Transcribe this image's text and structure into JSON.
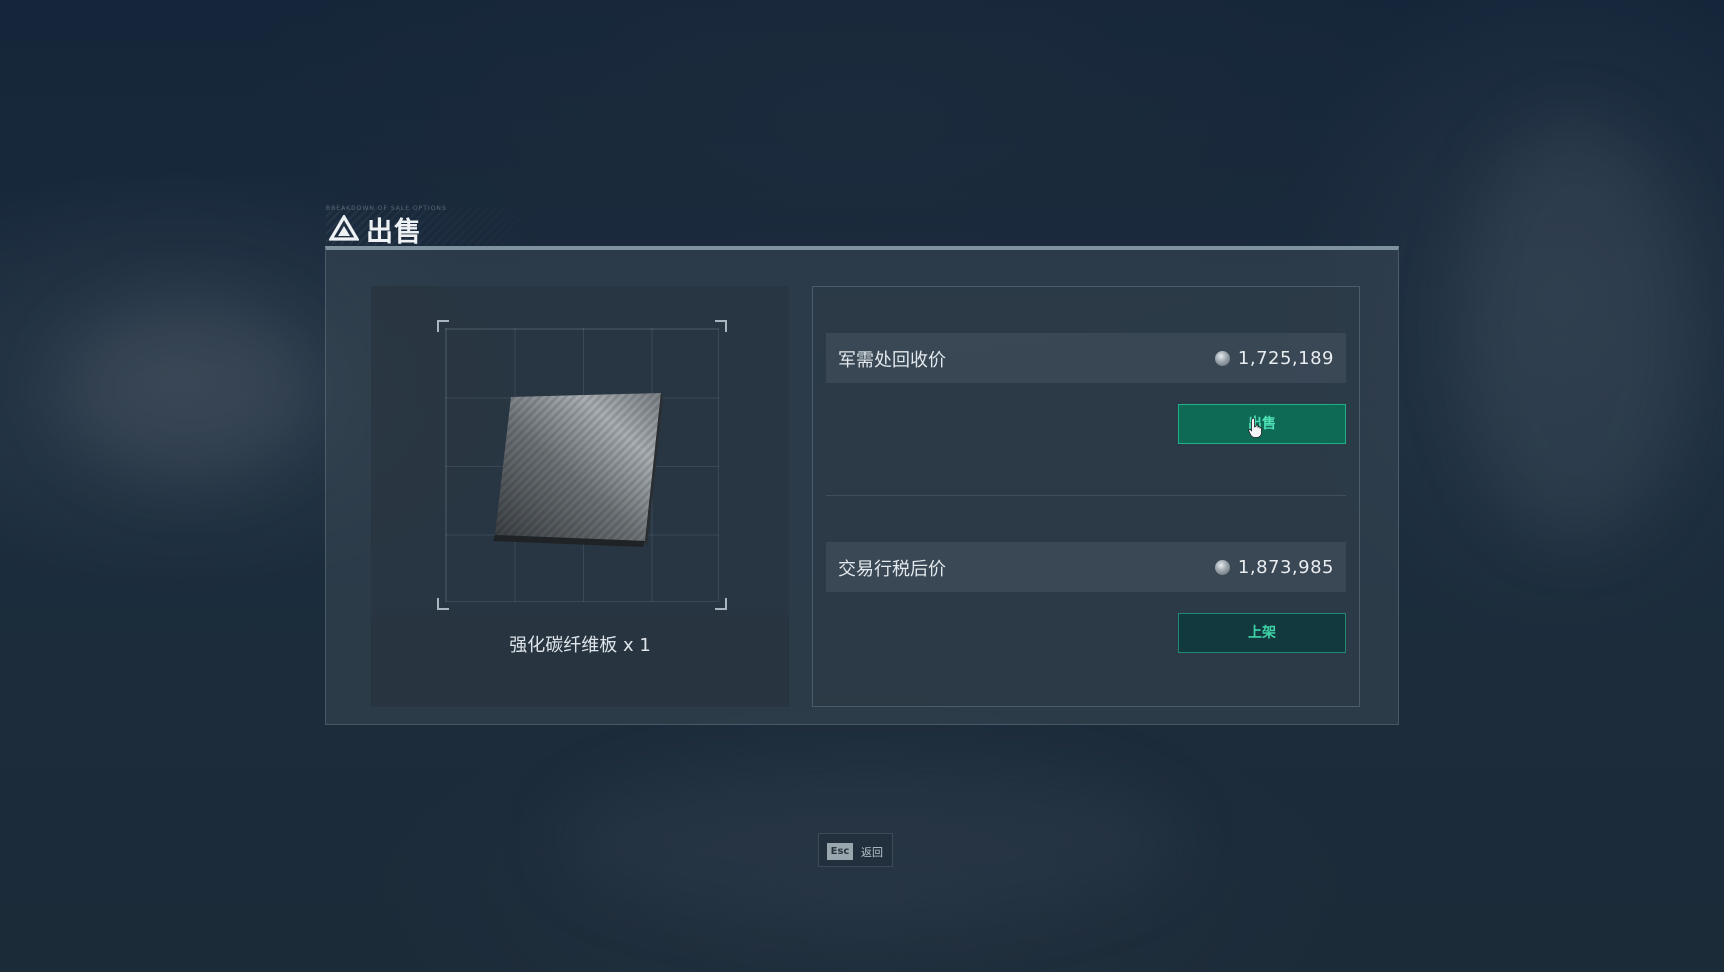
{
  "header": {
    "title": "出售",
    "tiny_text": "BREAKDOWN OF SALE OPTIONS",
    "icon": "delta-triangle-icon"
  },
  "item": {
    "name_label": "强化碳纤维板 x 1",
    "icon": "carbon-fiber-plate-icon"
  },
  "options": {
    "recycle": {
      "label": "军需处回收价",
      "price": "1,725,189",
      "button_label": "出售"
    },
    "market": {
      "label": "交易行税后价",
      "price": "1,873,985",
      "button_label": "上架"
    },
    "currency_icon": "silver-coin-icon"
  },
  "footer": {
    "key": "Esc",
    "action": "返回"
  },
  "colors": {
    "accent_green": "#1fae86",
    "button_sell_bg": "#0f6a55",
    "panel_top_border": "#7f929f",
    "background": "#1b2c3d"
  }
}
